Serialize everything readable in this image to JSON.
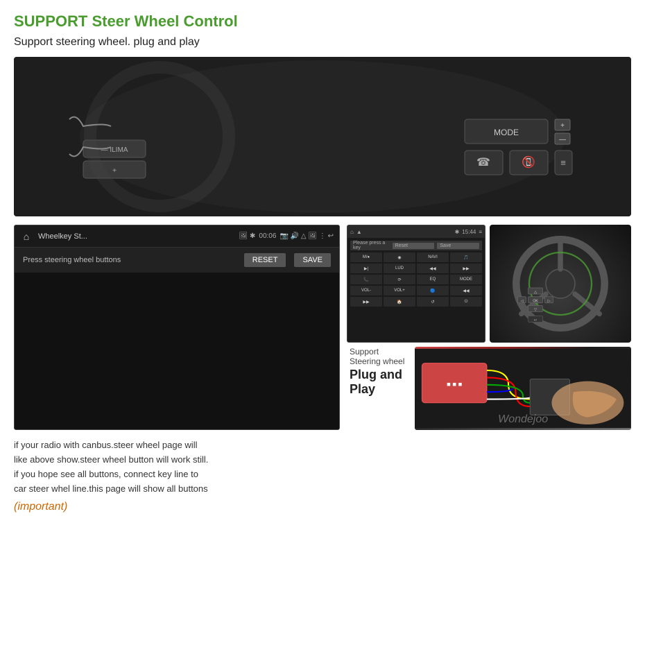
{
  "header": {
    "title_support": "SUPPORT",
    "title_steer": " Steer",
    "title_wheel": " Wheel",
    "title_control": " Control",
    "subtitle": "Support steering wheel. plug and play"
  },
  "left_panel": {
    "app_name": "Wheelkey St...",
    "time": "00:06",
    "press_text": "Press steering wheel buttons",
    "btn_reset": "RESET",
    "btn_save": "SAVE"
  },
  "right_panel": {
    "mini_time": "15:44",
    "mini_press": "Please press a key",
    "mini_reset": "Reset",
    "mini_save": "Save",
    "grid_items": [
      "M/●",
      "◉",
      "NAVI",
      "🎵",
      "▶|",
      "LUD",
      "◀◀",
      "▶▶",
      "📞",
      "⟳",
      "◀◀",
      "EQ",
      "MODE",
      "VOL-",
      "VOL+",
      "🔵",
      "◀◀",
      "▶▶",
      "🏠",
      "↺",
      "⏻"
    ],
    "support_steering": "Support Steering wheel",
    "plug_play": "Plug and Play"
  },
  "description": {
    "line1": "if your radio with canbus.steer wheel page will",
    "line2": "like above show.steer wheel button will work still.",
    "line3": "if you hope see all buttons, connect key line to",
    "line4": "car steer whel line.this page will show all buttons"
  },
  "important": "(important)",
  "watermark": "Wondejoo"
}
